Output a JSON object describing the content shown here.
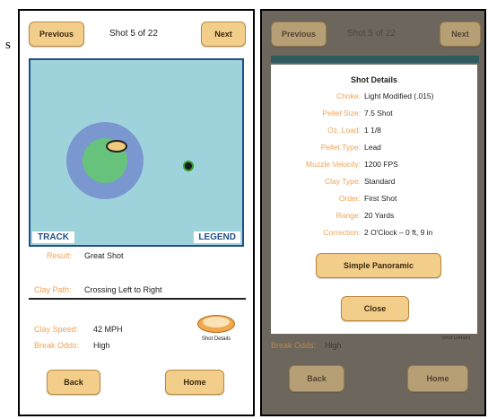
{
  "stray_char": "s",
  "left": {
    "prev_label": "Previous",
    "title": "Shot 5 of 22",
    "next_label": "Next",
    "track_label": "TRACK",
    "legend_label": "LEGEND",
    "result_label": "Result:",
    "result_value": "Great Shot",
    "clay_path_label": "Clay Path:",
    "clay_path_value": "Crossing Left to Right",
    "clay_speed_label": "Clay Speed:",
    "clay_speed_value": "42 MPH",
    "break_odds_label": "Break Odds:",
    "break_odds_value": "High",
    "shot_details_label": "Shot Details",
    "back_label": "Back",
    "home_label": "Home",
    "colors": {
      "accent": "#f3cd8a",
      "label": "#f1a255",
      "field": "#9fd3dc",
      "outer_ring": "#7b97cf",
      "inner_ring": "#67c37c"
    }
  },
  "right": {
    "prev_label": "Previous",
    "title": "Shot 5 of 22",
    "next_label": "Next",
    "dialog_title": "Shot Details",
    "details": [
      {
        "key": "Choke:",
        "value": "Light Modified (.015)"
      },
      {
        "key": "Pellet Size:",
        "value": "7.5 Shot"
      },
      {
        "key": "Oz. Load:",
        "value": "1 1/8"
      },
      {
        "key": "Pellet Type:",
        "value": "Lead"
      },
      {
        "key": "Muzzle Velocity:",
        "value": "1200 FPS"
      },
      {
        "key": "Clay Type:",
        "value": "Standard"
      },
      {
        "key": "Order:",
        "value": "First Shot"
      },
      {
        "key": "Range:",
        "value": "20 Yards"
      },
      {
        "key": "Correction:",
        "value": "2 O'Clock – 0 ft, 9 in"
      }
    ],
    "panoramic_label": "Simple Panoramic",
    "close_label": "Close",
    "break_odds_label": "Break Odds:",
    "break_odds_value": "High",
    "shot_details_label": "Shot Details",
    "back_label": "Back",
    "home_label": "Home"
  }
}
